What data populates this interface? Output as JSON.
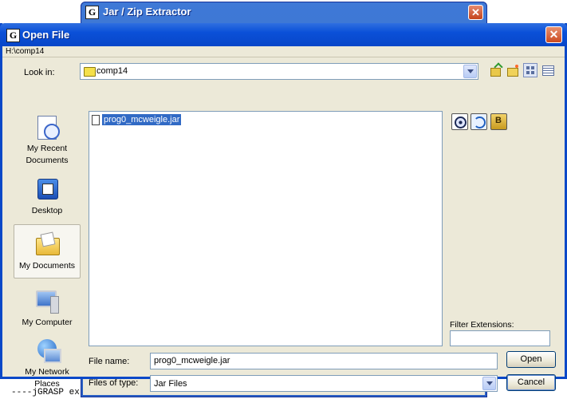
{
  "background": {
    "console_text": "----jGRASP ex"
  },
  "extractor": {
    "title": "Jar / Zip Extractor",
    "icon": "jgrasp-g-icon"
  },
  "dialog": {
    "title": "Open File",
    "icon": "jgrasp-g-icon",
    "path": "H:\\comp14",
    "look_in_label": "Look in:",
    "look_in_value": "comp14",
    "places": [
      {
        "label": "My Recent Documents",
        "icon": "recent-documents-icon"
      },
      {
        "label": "Desktop",
        "icon": "desktop-icon"
      },
      {
        "label": "My Documents",
        "icon": "my-documents-icon"
      },
      {
        "label": "My Computer",
        "icon": "my-computer-icon"
      },
      {
        "label": "My Network Places",
        "icon": "network-places-icon"
      }
    ],
    "files": [
      {
        "name": "prog0_mcweigle.jar"
      }
    ],
    "filter_label": "Filter Extensions:",
    "filter_value": "",
    "file_name_label": "File name:",
    "file_name_value": "prog0_mcweigle.jar",
    "file_type_label": "Files of type:",
    "file_type_value": "Jar Files",
    "open_label": "Open",
    "cancel_label": "Cancel"
  },
  "colors": {
    "titlebar": "#0a50d8",
    "dialog_bg": "#ece9d8",
    "selection": "#316ac5",
    "close_button": "#cc4a20"
  }
}
